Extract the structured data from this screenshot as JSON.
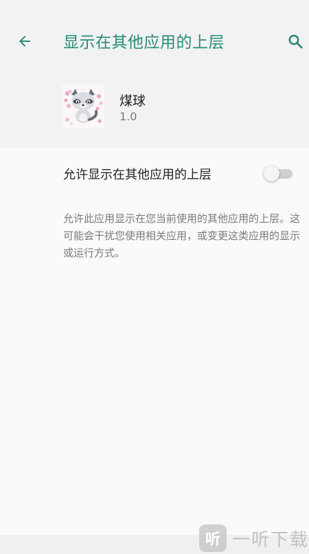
{
  "header": {
    "title": "显示在其他应用的上层",
    "back_icon": "arrow-left-icon",
    "search_icon": "search-icon",
    "accent_color": "#2a8a74"
  },
  "app": {
    "name": "煤球",
    "version": "1.0",
    "icon": "raccoon-app-icon"
  },
  "setting": {
    "label": "允许显示在其他应用的上层",
    "toggle_on": false
  },
  "description": "允许此应用显示在您当前使用的其他应用的上层。这可能会干扰您使用相关应用，或变更这类应用的显示或运行方式。",
  "watermark": {
    "badge": "听",
    "text": "一听下载"
  }
}
